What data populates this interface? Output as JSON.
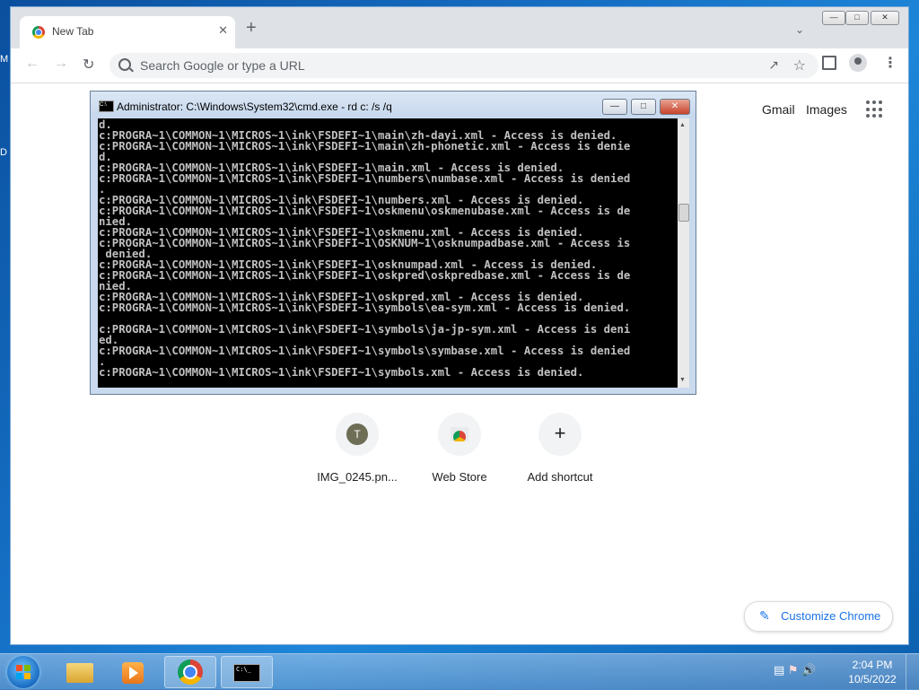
{
  "desktop": {
    "frag1": "M",
    "frag2": "D"
  },
  "browser": {
    "tab_title": "New Tab",
    "tab_close": "✕",
    "new_tab": "+",
    "tab_search": "⌄",
    "omnibox_placeholder": "Search Google or type a URL",
    "win_min": "—",
    "win_max": "□",
    "win_close": "✕",
    "links": {
      "gmail": "Gmail",
      "images": "Images"
    },
    "shortcuts": [
      {
        "label": "IMG_0245.pn...",
        "initial": "T"
      },
      {
        "label": "Web Store"
      },
      {
        "label": "Add shortcut",
        "symbol": "+"
      }
    ],
    "customize_label": "Customize Chrome"
  },
  "cmd": {
    "title": "Administrator: C:\\Windows\\System32\\cmd.exe - rd  c: /s /q",
    "console_text": "d.\nc:PROGRA~1\\COMMON~1\\MICROS~1\\ink\\FSDEFI~1\\main\\zh-dayi.xml - Access is denied.\nc:PROGRA~1\\COMMON~1\\MICROS~1\\ink\\FSDEFI~1\\main\\zh-phonetic.xml - Access is denie\nd.\nc:PROGRA~1\\COMMON~1\\MICROS~1\\ink\\FSDEFI~1\\main.xml - Access is denied.\nc:PROGRA~1\\COMMON~1\\MICROS~1\\ink\\FSDEFI~1\\numbers\\numbase.xml - Access is denied\n.\nc:PROGRA~1\\COMMON~1\\MICROS~1\\ink\\FSDEFI~1\\numbers.xml - Access is denied.\nc:PROGRA~1\\COMMON~1\\MICROS~1\\ink\\FSDEFI~1\\oskmenu\\oskmenubase.xml - Access is de\nnied.\nc:PROGRA~1\\COMMON~1\\MICROS~1\\ink\\FSDEFI~1\\oskmenu.xml - Access is denied.\nc:PROGRA~1\\COMMON~1\\MICROS~1\\ink\\FSDEFI~1\\OSKNUM~1\\osknumpadbase.xml - Access is\n denied.\nc:PROGRA~1\\COMMON~1\\MICROS~1\\ink\\FSDEFI~1\\osknumpad.xml - Access is denied.\nc:PROGRA~1\\COMMON~1\\MICROS~1\\ink\\FSDEFI~1\\oskpred\\oskpredbase.xml - Access is de\nnied.\nc:PROGRA~1\\COMMON~1\\MICROS~1\\ink\\FSDEFI~1\\oskpred.xml - Access is denied.\nc:PROGRA~1\\COMMON~1\\MICROS~1\\ink\\FSDEFI~1\\symbols\\ea-sym.xml - Access is denied.\n\nc:PROGRA~1\\COMMON~1\\MICROS~1\\ink\\FSDEFI~1\\symbols\\ja-jp-sym.xml - Access is deni\ned.\nc:PROGRA~1\\COMMON~1\\MICROS~1\\ink\\FSDEFI~1\\symbols\\symbase.xml - Access is denied\n.\nc:PROGRA~1\\COMMON~1\\MICROS~1\\ink\\FSDEFI~1\\symbols.xml - Access is denied.",
    "btn_min": "—",
    "btn_max": "□",
    "btn_close": "✕",
    "icon_text": "C:\\"
  },
  "taskbar": {
    "time": "2:04 PM",
    "date": "10/5/2022",
    "cmd_icon_text": "C:\\_"
  },
  "colors": {
    "accent": "#1a73e8",
    "console_bg": "#000000",
    "console_fg": "#c0c0c0"
  }
}
